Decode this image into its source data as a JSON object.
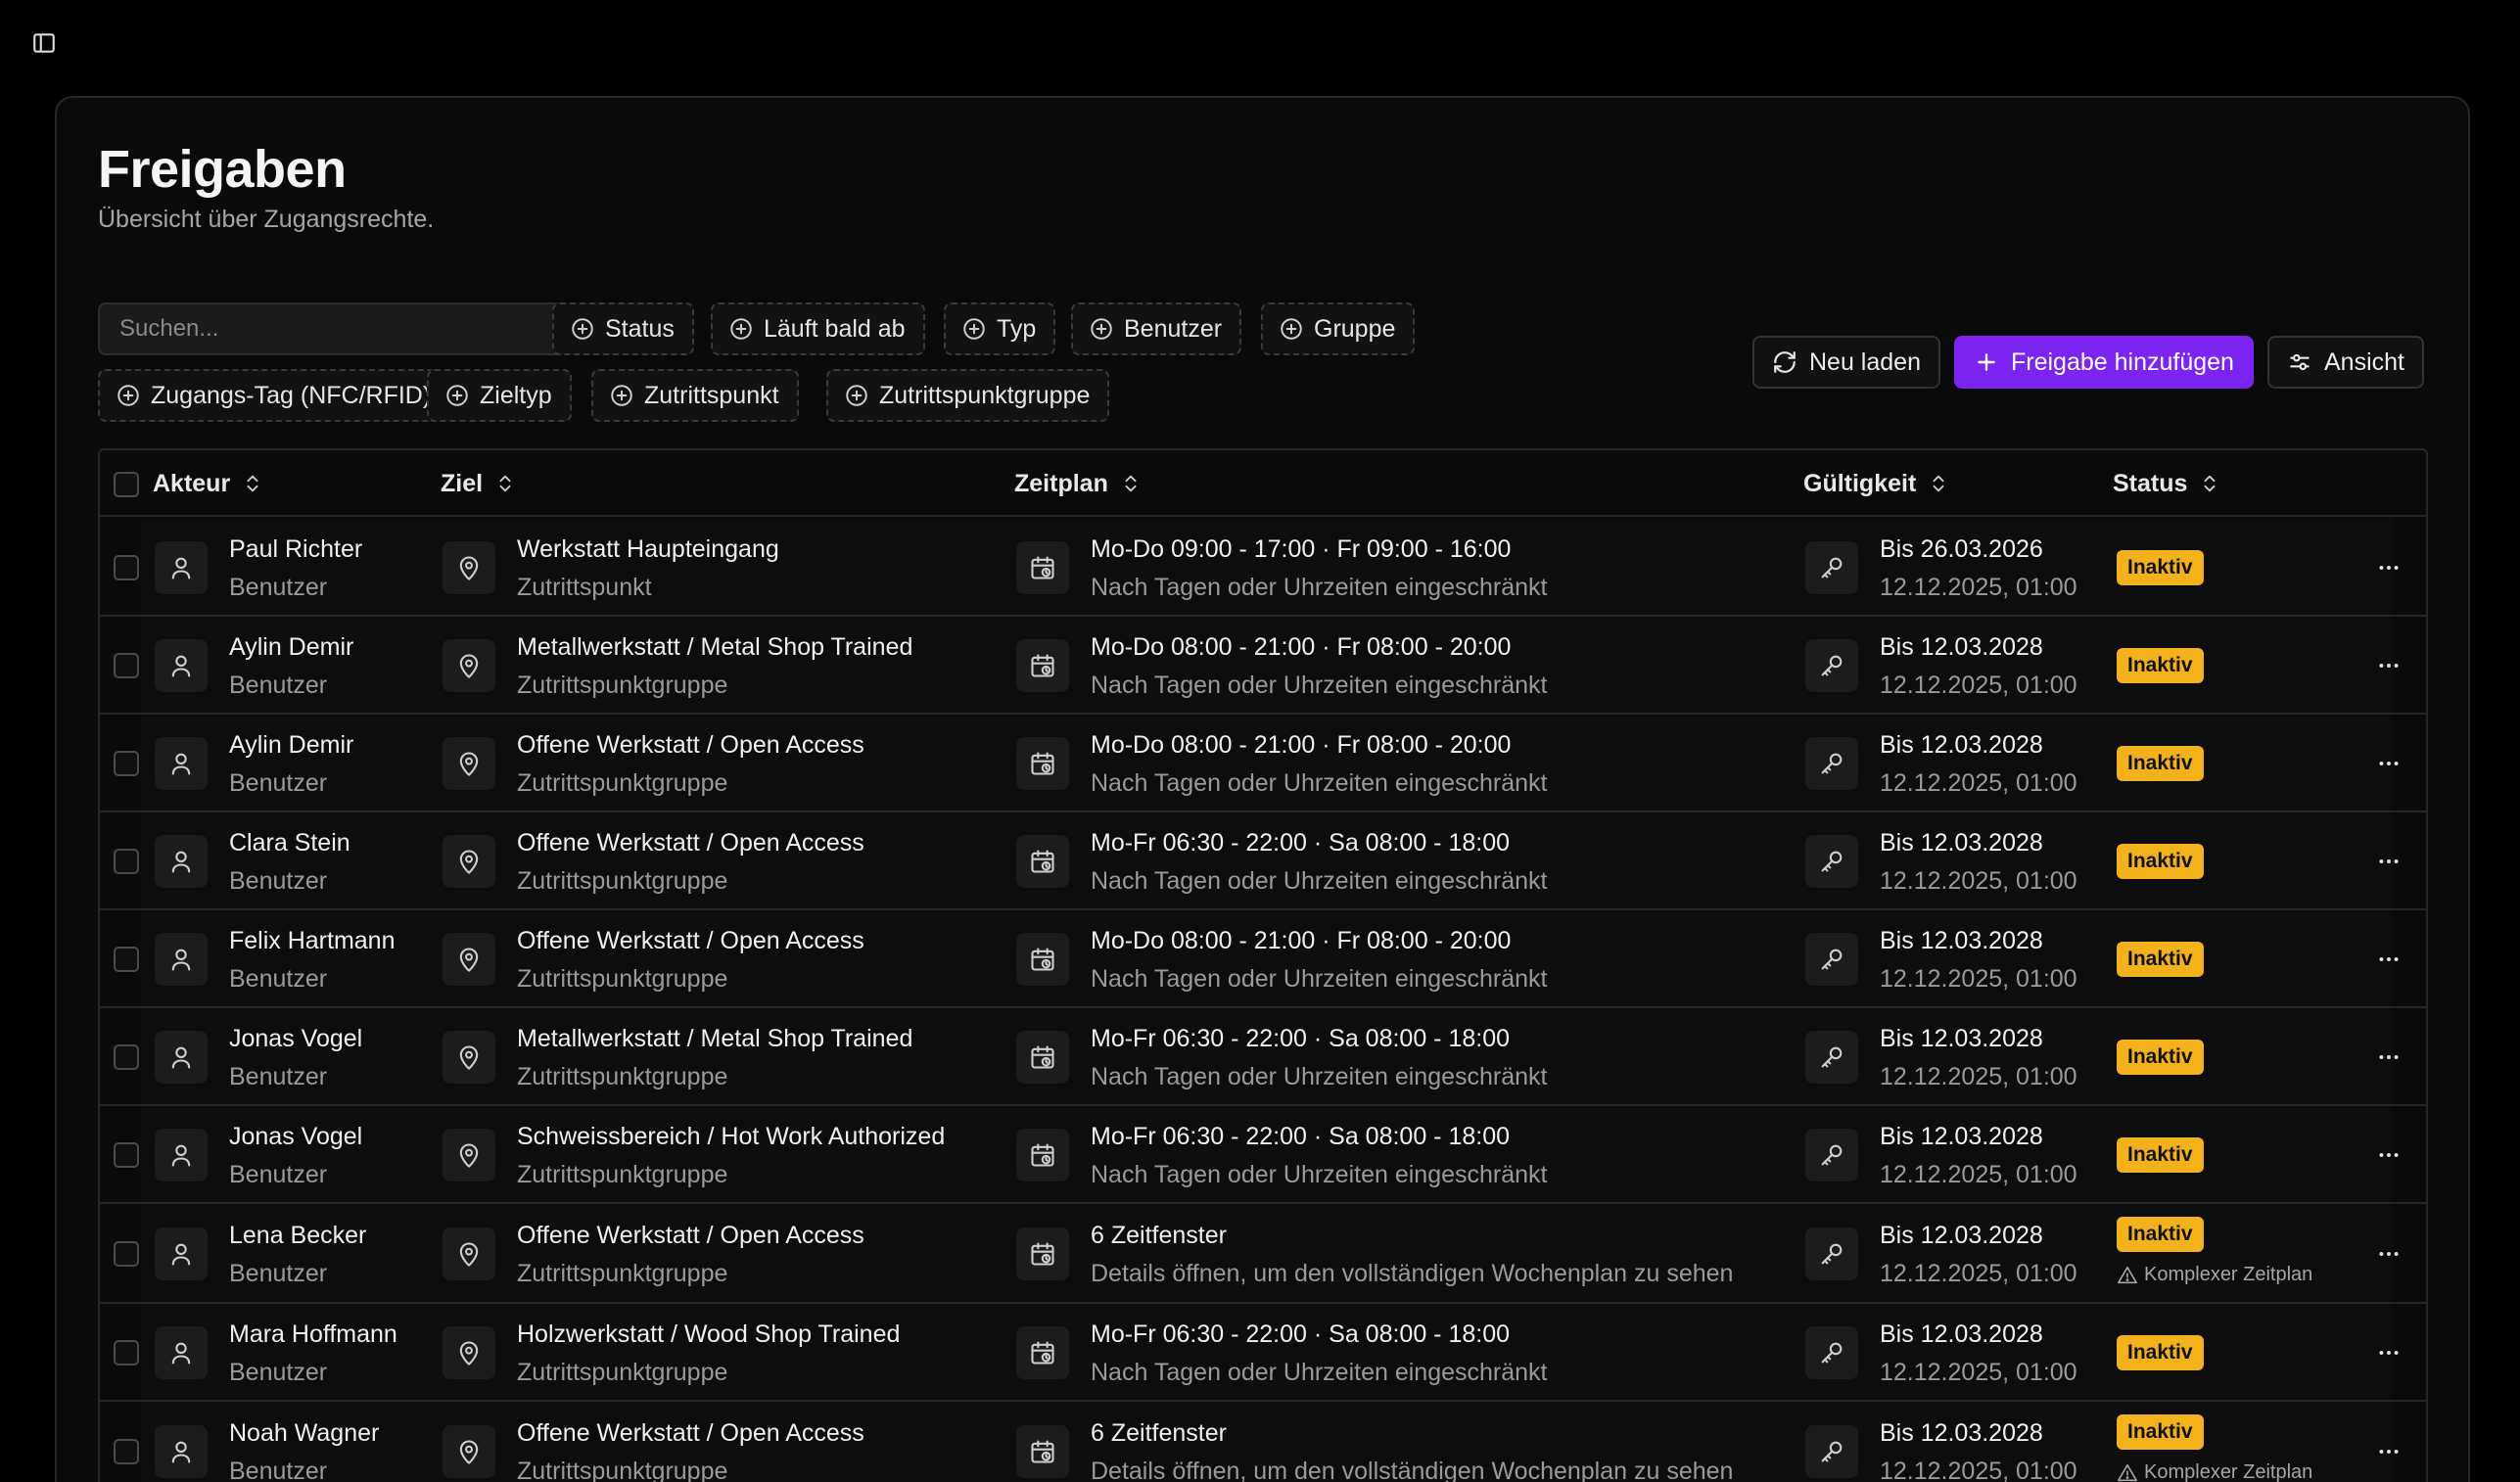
{
  "page": {
    "title": "Freigaben",
    "subtitle": "Übersicht über Zugangsrechte."
  },
  "search": {
    "placeholder": "Suchen...",
    "value": ""
  },
  "filters": [
    "Status",
    "Läuft bald ab",
    "Typ",
    "Benutzer",
    "Gruppe",
    "Zugangs-Tag (NFC/RFID)",
    "Zieltyp",
    "Zutrittspunkt",
    "Zutrittspunktgruppe"
  ],
  "actions": {
    "reload": "Neu laden",
    "add": "Freigabe hinzufügen",
    "view": "Ansicht"
  },
  "columns": {
    "actor": "Akteur",
    "target": "Ziel",
    "schedule": "Zeitplan",
    "validity": "Gültigkeit",
    "status": "Status"
  },
  "rows": [
    {
      "actor": "Paul Richter",
      "actor_type": "Benutzer",
      "target": "Werkstatt Haupteingang",
      "target_type": "Zutrittspunkt",
      "schedule": "Mo-Do 09:00 - 17:00 · Fr 09:00 - 16:00",
      "schedule_note": "Nach Tagen oder Uhrzeiten eingeschränkt",
      "valid_until": "Bis 26.03.2026",
      "valid_from": "12.12.2025, 01:00",
      "status": "Inaktiv",
      "warning": ""
    },
    {
      "actor": "Aylin Demir",
      "actor_type": "Benutzer",
      "target": "Metallwerkstatt / Metal Shop Trained",
      "target_type": "Zutrittspunktgruppe",
      "schedule": "Mo-Do 08:00 - 21:00 · Fr 08:00 - 20:00",
      "schedule_note": "Nach Tagen oder Uhrzeiten eingeschränkt",
      "valid_until": "Bis 12.03.2028",
      "valid_from": "12.12.2025, 01:00",
      "status": "Inaktiv",
      "warning": ""
    },
    {
      "actor": "Aylin Demir",
      "actor_type": "Benutzer",
      "target": "Offene Werkstatt / Open Access",
      "target_type": "Zutrittspunktgruppe",
      "schedule": "Mo-Do 08:00 - 21:00 · Fr 08:00 - 20:00",
      "schedule_note": "Nach Tagen oder Uhrzeiten eingeschränkt",
      "valid_until": "Bis 12.03.2028",
      "valid_from": "12.12.2025, 01:00",
      "status": "Inaktiv",
      "warning": ""
    },
    {
      "actor": "Clara Stein",
      "actor_type": "Benutzer",
      "target": "Offene Werkstatt / Open Access",
      "target_type": "Zutrittspunktgruppe",
      "schedule": "Mo-Fr 06:30 - 22:00 · Sa 08:00 - 18:00",
      "schedule_note": "Nach Tagen oder Uhrzeiten eingeschränkt",
      "valid_until": "Bis 12.03.2028",
      "valid_from": "12.12.2025, 01:00",
      "status": "Inaktiv",
      "warning": ""
    },
    {
      "actor": "Felix Hartmann",
      "actor_type": "Benutzer",
      "target": "Offene Werkstatt / Open Access",
      "target_type": "Zutrittspunktgruppe",
      "schedule": "Mo-Do 08:00 - 21:00 · Fr 08:00 - 20:00",
      "schedule_note": "Nach Tagen oder Uhrzeiten eingeschränkt",
      "valid_until": "Bis 12.03.2028",
      "valid_from": "12.12.2025, 01:00",
      "status": "Inaktiv",
      "warning": ""
    },
    {
      "actor": "Jonas Vogel",
      "actor_type": "Benutzer",
      "target": "Metallwerkstatt / Metal Shop Trained",
      "target_type": "Zutrittspunktgruppe",
      "schedule": "Mo-Fr 06:30 - 22:00 · Sa 08:00 - 18:00",
      "schedule_note": "Nach Tagen oder Uhrzeiten eingeschränkt",
      "valid_until": "Bis 12.03.2028",
      "valid_from": "12.12.2025, 01:00",
      "status": "Inaktiv",
      "warning": ""
    },
    {
      "actor": "Jonas Vogel",
      "actor_type": "Benutzer",
      "target": "Schweissbereich / Hot Work Authorized",
      "target_type": "Zutrittspunktgruppe",
      "schedule": "Mo-Fr 06:30 - 22:00 · Sa 08:00 - 18:00",
      "schedule_note": "Nach Tagen oder Uhrzeiten eingeschränkt",
      "valid_until": "Bis 12.03.2028",
      "valid_from": "12.12.2025, 01:00",
      "status": "Inaktiv",
      "warning": ""
    },
    {
      "actor": "Lena Becker",
      "actor_type": "Benutzer",
      "target": "Offene Werkstatt / Open Access",
      "target_type": "Zutrittspunktgruppe",
      "schedule": "6 Zeitfenster",
      "schedule_note": "Details öffnen, um den vollständigen Wochenplan zu sehen",
      "valid_until": "Bis 12.03.2028",
      "valid_from": "12.12.2025, 01:00",
      "status": "Inaktiv",
      "warning": "Komplexer Zeitplan"
    },
    {
      "actor": "Mara Hoffmann",
      "actor_type": "Benutzer",
      "target": "Holzwerkstatt / Wood Shop Trained",
      "target_type": "Zutrittspunktgruppe",
      "schedule": "Mo-Fr 06:30 - 22:00 · Sa 08:00 - 18:00",
      "schedule_note": "Nach Tagen oder Uhrzeiten eingeschränkt",
      "valid_until": "Bis 12.03.2028",
      "valid_from": "12.12.2025, 01:00",
      "status": "Inaktiv",
      "warning": ""
    },
    {
      "actor": "Noah Wagner",
      "actor_type": "Benutzer",
      "target": "Offene Werkstatt / Open Access",
      "target_type": "Zutrittspunktgruppe",
      "schedule": "6 Zeitfenster",
      "schedule_note": "Details öffnen, um den vollständigen Wochenplan zu sehen",
      "valid_until": "Bis 12.03.2028",
      "valid_from": "12.12.2025, 01:00",
      "status": "Inaktiv",
      "warning": "Komplexer Zeitplan"
    }
  ],
  "colors": {
    "accent": "#7c25f2",
    "badge_inactive": "#f3b11c",
    "background": "#000000",
    "panel": "#0a0a0a"
  },
  "icons": {
    "sidebar_toggle": "sidebar-toggle-icon",
    "actor": "user-icon",
    "target": "map-pin-icon",
    "schedule": "calendar-clock-icon",
    "validity": "key-icon",
    "row_menu": "more-horizontal-icon",
    "warning": "warning-triangle-icon"
  }
}
